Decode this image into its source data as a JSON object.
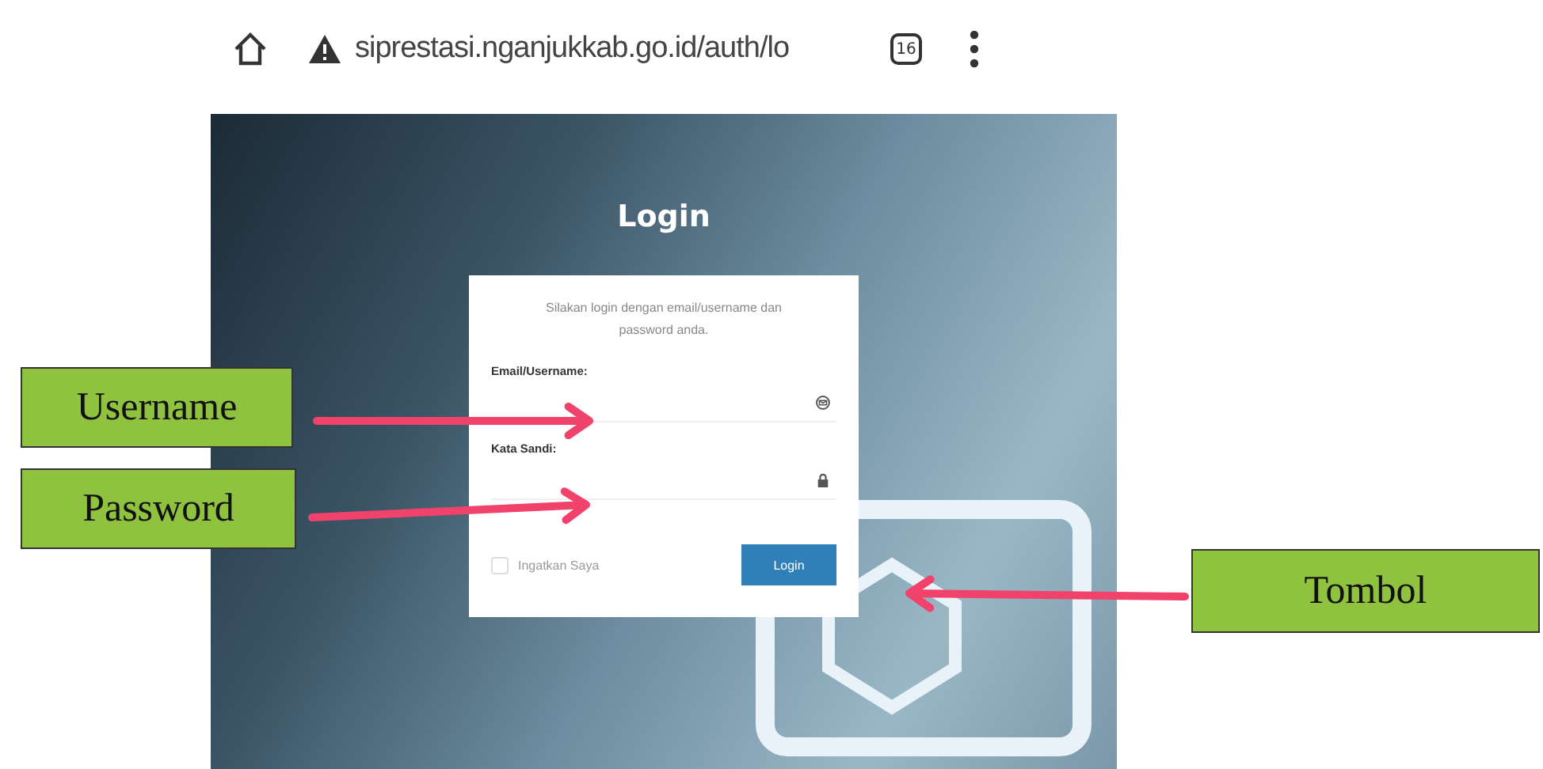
{
  "browser": {
    "url": "siprestasi.nganjukkab.go.id/auth/lo",
    "tab_count": "16"
  },
  "login": {
    "title": "Login",
    "intro": "Silakan login dengan email/username dan password anda.",
    "fields": [
      {
        "label": "Email/Username:",
        "kind": "email"
      },
      {
        "label": "Kata Sandi:",
        "kind": "password"
      }
    ],
    "remember": {
      "label": "Ingatkan Saya",
      "checked": false
    },
    "button": "Login"
  },
  "annotations": [
    {
      "text": "Username"
    },
    {
      "text": "Password"
    },
    {
      "text": "Tombol"
    }
  ]
}
